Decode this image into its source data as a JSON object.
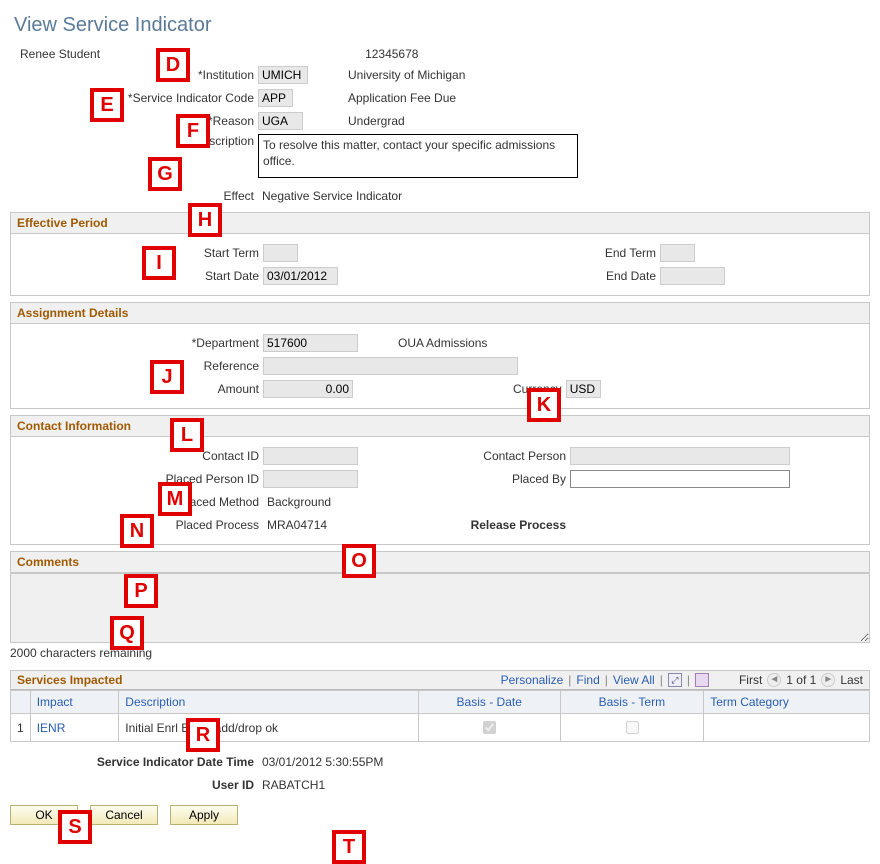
{
  "page_title": "View Service Indicator",
  "student_name": "Renee Student",
  "student_id": "12345678",
  "institution": {
    "label": "Institution",
    "value": "UMICH",
    "display": "University of Michigan"
  },
  "svc_code": {
    "label": "Service Indicator Code",
    "value": "APP",
    "display": "Application Fee Due"
  },
  "reason": {
    "label": "Reason",
    "value": "UGA",
    "display": "Undergrad"
  },
  "description": {
    "label": "Description",
    "value": "To resolve this matter, contact your specific admissions office."
  },
  "effect": {
    "label": "Effect",
    "value": "Negative Service Indicator"
  },
  "sections": {
    "effective": {
      "title": "Effective Period",
      "start_term_lbl": "Start Term",
      "start_term": "",
      "end_term_lbl": "End Term",
      "end_term": "",
      "start_date_lbl": "Start Date",
      "start_date": "03/01/2012",
      "end_date_lbl": "End Date",
      "end_date": ""
    },
    "assignment": {
      "title": "Assignment Details",
      "department_lbl": "Department",
      "department": "517600",
      "department_display": "OUA Admissions",
      "reference_lbl": "Reference",
      "reference": "",
      "amount_lbl": "Amount",
      "amount": "0.00",
      "currency_lbl": "Currency",
      "currency": "USD"
    },
    "contact": {
      "title": "Contact Information",
      "contact_id_lbl": "Contact ID",
      "contact_id": "",
      "contact_person_lbl": "Contact Person",
      "contact_person": "",
      "placed_person_id_lbl": "Placed Person ID",
      "placed_person_id": "",
      "placed_by_lbl": "Placed By",
      "placed_by": "",
      "placed_method_lbl": "Placed Method",
      "placed_method": "Background",
      "placed_process_lbl": "Placed Process",
      "placed_process": "MRA04714",
      "release_process_lbl": "Release Process",
      "release_process": ""
    },
    "comments": {
      "title": "Comments",
      "remaining": "2000 characters remaining",
      "value": ""
    }
  },
  "grid": {
    "title": "Services Impacted",
    "tools": {
      "personalize": "Personalize",
      "find": "Find",
      "view_all": "View All",
      "first": "First",
      "pos": "1 of 1",
      "last": "Last"
    },
    "headers": {
      "impact": "Impact",
      "description": "Description",
      "basis_date": "Basis - Date",
      "basis_term": "Basis - Term",
      "term_cat": "Term Category"
    },
    "rows": [
      {
        "num": "1",
        "impact": "IENR",
        "description": "Initial Enrl Block-add/drop ok",
        "basis_date": true,
        "basis_term": false,
        "term_cat": ""
      }
    ]
  },
  "footer": {
    "si_datetime_lbl": "Service Indicator Date Time",
    "si_datetime": "03/01/2012  5:30:55PM",
    "userid_lbl": "User ID",
    "userid": "RABATCH1"
  },
  "buttons": {
    "ok": "OK",
    "cancel": "Cancel",
    "apply": "Apply"
  },
  "annotations": [
    "D",
    "E",
    "F",
    "G",
    "H",
    "I",
    "J",
    "K",
    "L",
    "M",
    "N",
    "O",
    "P",
    "Q",
    "R",
    "S",
    "T"
  ]
}
